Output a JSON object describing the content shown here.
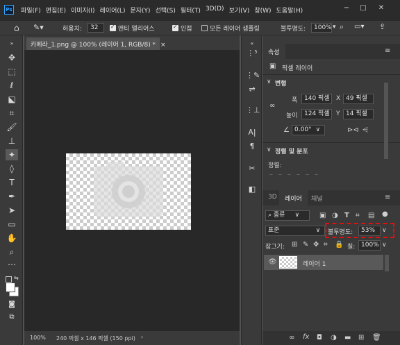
{
  "app": {
    "logo": "Ps"
  },
  "menu": [
    "파일(F)",
    "편집(E)",
    "이미지(I)",
    "레이어(L)",
    "문자(Y)",
    "선택(S)",
    "필터(T)",
    "3D(D)",
    "보기(V)",
    "창(W)",
    "도움말(H)"
  ],
  "window_controls": {
    "minimize": "−",
    "maximize": "□",
    "close": "✕"
  },
  "options": {
    "tolerance_label": "허용치:",
    "tolerance_value": "32",
    "antialias_label": "앤티 앨리어스",
    "contiguous_label": "인접",
    "all_layers_label": "모든 레이어 샘플링",
    "opacity_label": "불투명도:",
    "opacity_value": "100%"
  },
  "document": {
    "tab_title": "카메라_1.png @ 100% (레이어 1, RGB/8) *",
    "close": "×",
    "zoom": "100%",
    "size_info": "240 픽셀 x 146 픽셀 (150 ppi)",
    "arrow": "›"
  },
  "properties": {
    "tab_label": "속성",
    "pixel_layer_label": "픽셀 레이어",
    "transform_header": "변형",
    "w_label": "폭",
    "w_value": "140 픽셀",
    "x_label": "X",
    "x_value": "49 픽셀",
    "h_label": "높이",
    "h_value": "124 픽셀",
    "y_label": "Y",
    "y_value": "14 픽셀",
    "angle_value": "0.00°",
    "align_header": "정렬 및 분포",
    "align_label": "정렬:"
  },
  "layers": {
    "tabs": [
      "3D",
      "레이어",
      "채널"
    ],
    "active_tab": 1,
    "filter_label": "종류",
    "blend_mode": "표준",
    "opacity_label": "불투명도:",
    "opacity_value": "53%",
    "lock_label": "잠그기:",
    "fill_label": "칠:",
    "fill_value": "100%",
    "items": [
      {
        "name": "레이어 1",
        "visible": true
      }
    ]
  }
}
